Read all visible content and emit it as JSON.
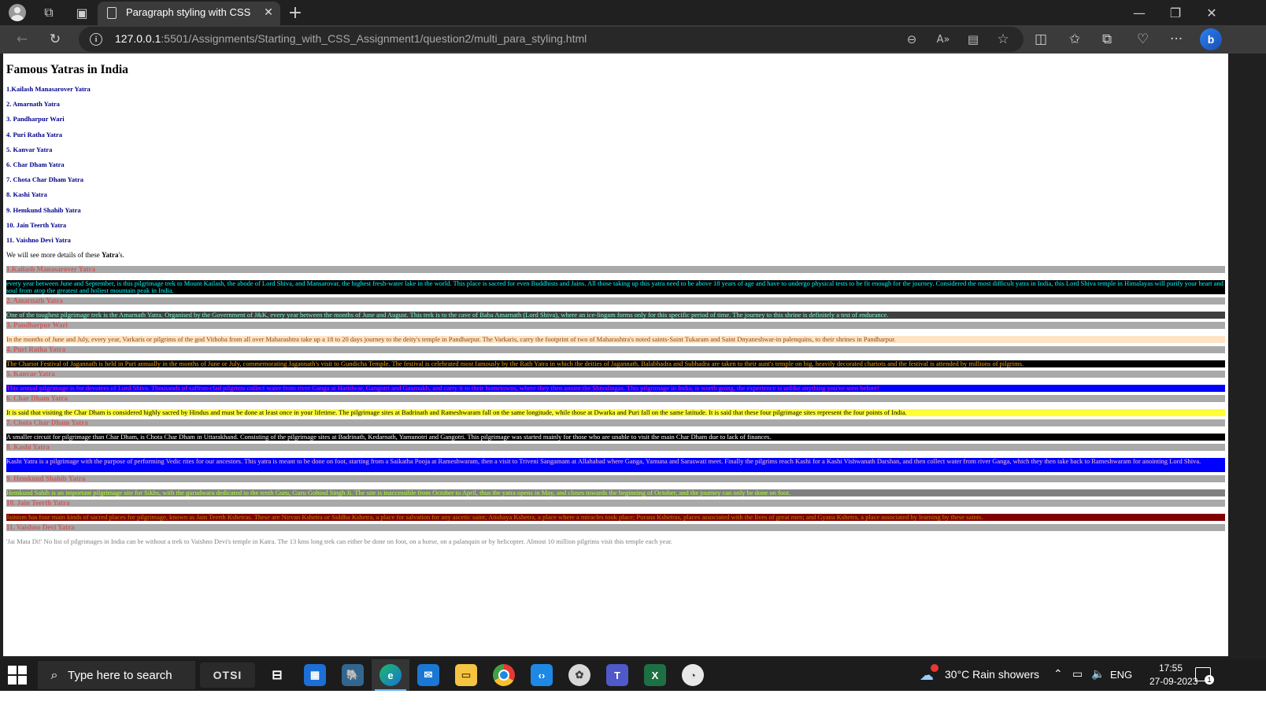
{
  "browser": {
    "tab_title": "Paragraph styling with CSS",
    "url_host": "127.0.0.1",
    "url_rest": ":5501/Assignments/Starting_with_CSS_Assignment1/question2/multi_para_styling.html"
  },
  "page": {
    "heading": "Famous Yatras in India",
    "list": [
      "1.Kailash Manasarover Yatra",
      "2. Amarnath Yatra",
      "3. Pandharpur Wari",
      "4. Puri Ratha Yatra",
      "5. Kanvar Yatra",
      "6. Char Dham Yatra",
      "7. Chota Char Dham Yatra",
      "8. Kashi Yatra",
      "9. Hemkund Shahib Yatra",
      "10. Jain Teerth Yatra",
      "11. Vaishno Devi Yatra"
    ],
    "intro_before": "We will see more details of these ",
    "intro_bold": "Yatra",
    "intro_after": "'s.",
    "sections": [
      {
        "title": "1.Kailash Manasarover Yatra",
        "text": "every year between June and September, is this pilgrimage trek to Mount Kailash, the abode of Lord Shiva, and Mansarovar, the highest fresh-water lake in the world. This place is sacred for even Buddhists and Jains. All those taking up this yatra need to be above 18 years of age and have to undergo physical tests to be fit enough for the journey. Considered the most difficult yatra in India, this Lord Shiva temple in Himalayas will purify your heart and soul from atop the greatest and holiest mountain peak in India.",
        "bg": "#000000",
        "color": "#00ffff"
      },
      {
        "title": "2. Amarnath Yatra",
        "text": "One of the toughest pilgrimage trek is the Amarnath Yatra. Organised by the Government of J&K, every year between the months of June and August. This trek is to the cave of Baba Amarnath (Lord Shiva), where an ice-lingam forms only for this specific period of time. The journey to this shrine is definitely a test of endurance.",
        "bg": "#404040",
        "color": "#7fffd4"
      },
      {
        "title": "3. Pandharpur Wari",
        "text": "In the months of June and July, every year, Varkaris or pilgrims of the god Vithoba from all over Maharashtra take up a 18 to 20 days journey to the deity's temple in Pandharpur. The Varkaris, carry the footprint of two of Maharashtra's noted saints-Saint Tukaram and Saint Dnyaneshwar-in palenquins, to their shrines in Pandharpur.",
        "bg": "#ffe4c4",
        "color": "#8b4513"
      },
      {
        "title": "4. Puri Ratha Yatra",
        "text": "The Chariot Festival of Jagannath is held in Puri annually in the months of June or July, commemorating Jagannath's visit to Gundicha Temple. The festival is celebrated most famously by the Rath Yatra in which the deities of Jagannath, Balabhadra and Subhadra are taken to their aunt's temple on big, heavily decorated chariots and the festival is attended by millions of pilgrims.",
        "bg": "#000000",
        "color": "#ffa500"
      },
      {
        "title": "5. Kanvar Yatra",
        "text": "This annual pilgrimage is for devotees of Lord Shiva. Thousands of saffron-clad pilgrims collect water from river Ganga at Haridwar, Gangotri and Gaumukh, and carry it to their hometowns, where they then anoint the Shivalingas. This pilgrimage in India, is worth going, the experience is unlike anything you've seen before!",
        "bg": "#0000ff",
        "color": "#ff1493"
      },
      {
        "title": "6. Char Dham Yatra",
        "text": "It is said that visiting the Char Dham is considered highly sacred by Hindus and must be done at least once in your lifetime. The pilgrimage sites at Badrinath and Rameshwaram fall on the same longitude, while those at Dwarka and Puri fall on the same latitude. It is said that these four pilgrimage sites represent the four points of India.",
        "bg": "#ffff33",
        "color": "#000000"
      },
      {
        "title": "7. Chota Char Dham Yatra",
        "text": "A smaller circuit for pilgrimage than Char Dham, is Chota Char Dham in Uttarakhand. Consisting of the pilgrimage sites at Badrinath, Kedarnath, Yamunotri and Gangotri. This pilgrimage was started mainly for those who are unable to visit the main Char Dham due to lack of finances.",
        "bg": "#000000",
        "color": "#ffffff"
      },
      {
        "title": "8. Kashi Yatra",
        "text": "Kashi Yatra is a pilgrimage with the purpose of performing Vedic rites for our ancestors. This yatra is meant to be done on foot, starting from a Saikatha Pooja at Rameshwaram, then a visit to Triveni Sangamam at Allahabad where Ganga, Yamuna and Saraswati meet. Finally the pilgrims reach Kashi for a Kashi Vishwanath Darshan, and then collect water from river Ganga, which they then take back to Rameshwaram for anointing Lord Shiva.",
        "bg": "#0000ff",
        "color": "#ffc0cb"
      },
      {
        "title": "9. Hemkund Shahib Yatra",
        "text": "Hemkund Sahib is an important pilgrimage site for Sikhs, with the gurudwara dedicated to the tenth Guru, Guru Gobind Singh Ji. The site is inaccessible from October to April, thus the yatra opens in May, and closes towards the beginning of October, and the journey can only be done on foot.",
        "bg": "#808080",
        "color": "#adff2f"
      },
      {
        "title": "10. Jain Teerth Yatra",
        "text": "Jainism has four main kinds of sacred places for pilgrimage, known as Jain Teerth Kshetras. These are Nirvan Kshetra or Siddha Kshetra, a place for salvation for any ascetic saint; Atishaya Kshetra, a place where a miracles took place; Purana Kshetras, places associated with the lives of great men; and Gyana Kshetra, a place associated by learning by these saints.",
        "bg": "#800000",
        "color": "#b8860b"
      },
      {
        "title": "11. Vaishno Devi Yatra",
        "text": "'Jai Mata Di!' No list of pilgrimages in India can be without a trek to Vaishno Devi's temple in Katra. The 13 kms long trek can either be done on foot, on a horse, on a palanquin or by helicopter. Almost 10 million pilgrims visit this temple each year.",
        "bg": "#ffffff",
        "color": "#808080"
      }
    ]
  },
  "taskbar": {
    "search_placeholder": "Type here to search",
    "otsi_label": "OTSI",
    "weather": "30°C  Rain showers",
    "language": "ENG",
    "time": "17:55",
    "date": "27-09-2023",
    "notification_count": "1"
  }
}
